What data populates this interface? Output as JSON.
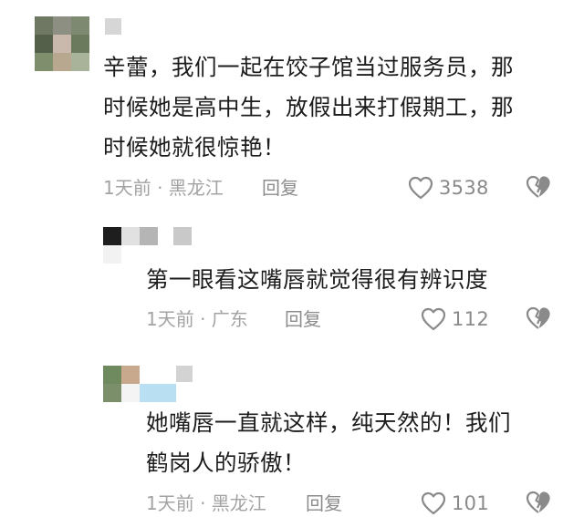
{
  "comments": [
    {
      "text": "辛蕾，我们一起在饺子馆当过服务员，那\n时候她是高中生，放假出来打假期工，那\n时候她就很惊艳！",
      "meta": "1天前 · 黑龙江",
      "reply_label": "回复",
      "likes": "3538"
    },
    {
      "text": "第一眼看这嘴唇就觉得很有辨识度",
      "meta": "1天前 · 广东",
      "reply_label": "回复",
      "likes": "112"
    },
    {
      "text": "她嘴唇一直就这样，纯天然的！我们\n鹤岗人的骄傲！",
      "meta": "1天前 · 黑龙江",
      "reply_label": "回复",
      "likes": "101"
    }
  ],
  "icons": {
    "like": "heart-outline-icon",
    "dislike": "broken-heart-icon"
  },
  "colors": {
    "text": "#1c1c1c",
    "meta": "#a3a3a3",
    "icon": "#8a8a8a"
  }
}
